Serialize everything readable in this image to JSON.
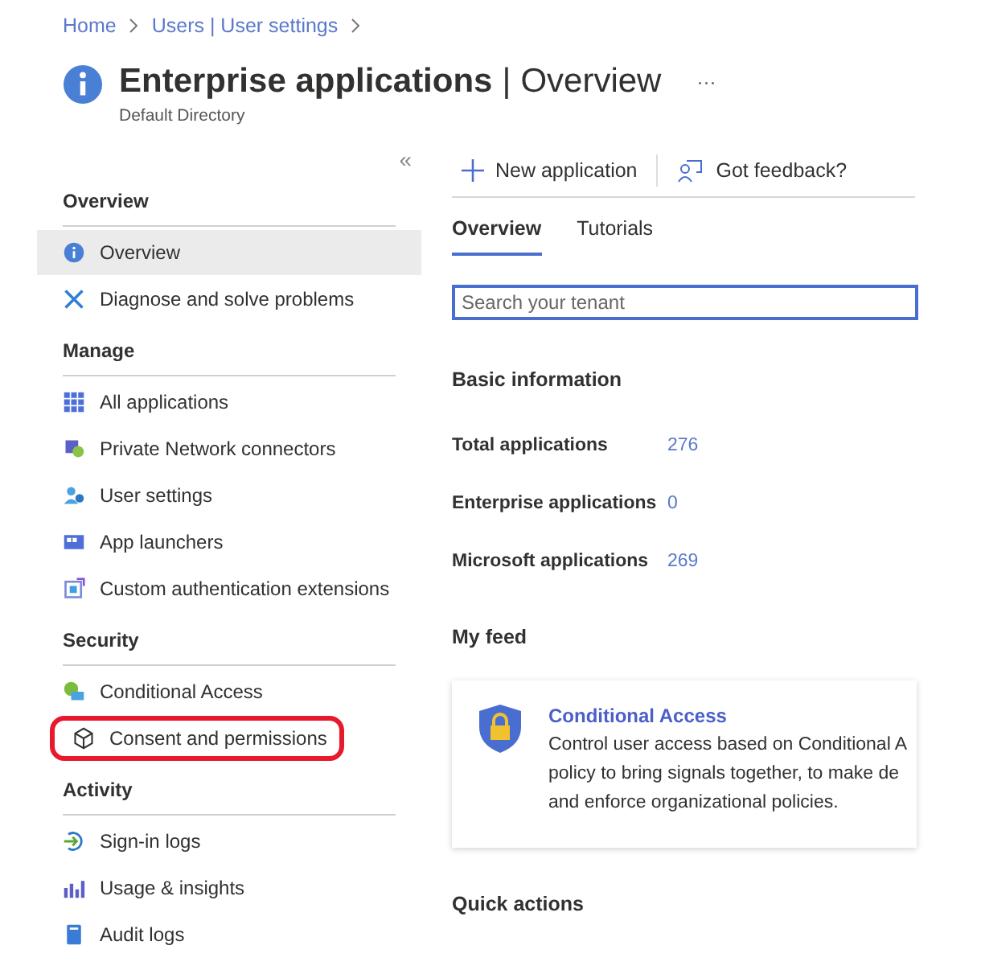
{
  "breadcrumb": [
    {
      "label": "Home"
    },
    {
      "label": "Users | User settings"
    }
  ],
  "header": {
    "title": "Enterprise applications",
    "separator": "|",
    "section": "Overview",
    "subtitle": "Default Directory",
    "more": "···"
  },
  "collapse": "«",
  "sidebar": [
    {
      "heading": "Overview",
      "items": [
        {
          "label": "Overview",
          "selected": true,
          "highlighted": false
        },
        {
          "label": "Diagnose and solve problems",
          "selected": false,
          "highlighted": false
        }
      ]
    },
    {
      "heading": "Manage",
      "items": [
        {
          "label": "All applications",
          "selected": false,
          "highlighted": false
        },
        {
          "label": "Private Network connectors",
          "selected": false,
          "highlighted": false
        },
        {
          "label": "User settings",
          "selected": false,
          "highlighted": false
        },
        {
          "label": "App launchers",
          "selected": false,
          "highlighted": false
        },
        {
          "label": "Custom authentication extensions",
          "selected": false,
          "highlighted": false
        }
      ]
    },
    {
      "heading": "Security",
      "items": [
        {
          "label": "Conditional Access",
          "selected": false,
          "highlighted": false
        },
        {
          "label": "Consent and permissions",
          "selected": false,
          "highlighted": true
        }
      ]
    },
    {
      "heading": "Activity",
      "items": [
        {
          "label": "Sign-in logs",
          "selected": false,
          "highlighted": false
        },
        {
          "label": "Usage & insights",
          "selected": false,
          "highlighted": false
        },
        {
          "label": "Audit logs",
          "selected": false,
          "highlighted": false
        }
      ]
    }
  ],
  "toolbar": [
    {
      "label": "New application"
    },
    {
      "label": "Got feedback?"
    }
  ],
  "tabs": [
    {
      "label": "Overview",
      "selected": true
    },
    {
      "label": "Tutorials",
      "selected": false
    }
  ],
  "search": {
    "placeholder": "Search your tenant"
  },
  "basic_info": {
    "title": "Basic information",
    "rows": [
      {
        "label": "Total applications",
        "value": "276"
      },
      {
        "label": "Enterprise applications",
        "value": "0"
      },
      {
        "label": "Microsoft applications",
        "value": "269"
      }
    ]
  },
  "feed": {
    "title": "My feed",
    "card": {
      "title": "Conditional Access",
      "lines": [
        "Control user access based on Conditional A",
        "policy to bring signals together, to make de",
        "and enforce organizational policies."
      ]
    }
  },
  "quick_actions": {
    "title": "Quick actions"
  }
}
